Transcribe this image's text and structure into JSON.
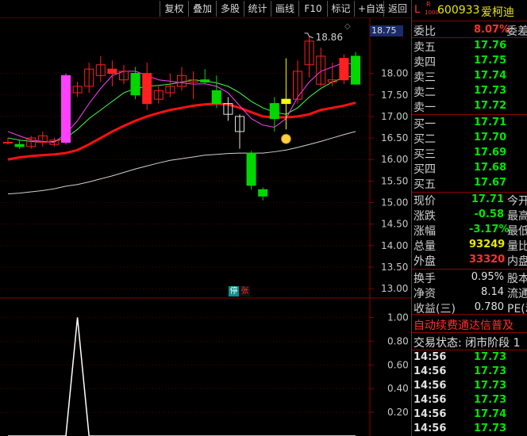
{
  "toolbar": {
    "buttons": [
      "复权",
      "叠加",
      "多股",
      "统计",
      "画线",
      "F10",
      "标记",
      "+自选",
      "返回"
    ]
  },
  "chart": {
    "current_price_box": "18.75",
    "high_annotation": "18.86",
    "y_ticks": [
      "18.00",
      "17.50",
      "17.00",
      "16.50",
      "16.00",
      "15.50",
      "15.00",
      "14.50",
      "14.00",
      "13.50",
      "13.00"
    ],
    "sub_ticks": [
      "1.00",
      "0.80",
      "0.60",
      "0.40",
      "0.20"
    ],
    "stop_badge": "停",
    "up_badge": "张",
    "colors": {
      "up": "#ff2020",
      "down": "#00d800",
      "ma5": "#ff40ff",
      "ma10": "#40ff40",
      "ma20": "#ff1010",
      "ma60": "#d0d0d0",
      "magenta_bar": "#ff40ff",
      "yellow_bar": "#ffff00"
    }
  },
  "chart_data": {
    "type": "candlestick",
    "y_range": [
      12.8,
      19.3
    ],
    "candles": [
      {
        "o": 16.4,
        "h": 16.5,
        "l": 16.35,
        "c": 16.4
      },
      {
        "o": 16.35,
        "h": 16.45,
        "l": 16.25,
        "c": 16.3
      },
      {
        "o": 16.3,
        "h": 16.55,
        "l": 16.25,
        "c": 16.5
      },
      {
        "o": 16.4,
        "h": 16.65,
        "l": 16.3,
        "c": 16.55
      },
      {
        "o": 16.35,
        "h": 16.5,
        "l": 16.3,
        "c": 16.45
      },
      {
        "o": 16.4,
        "h": 18.0,
        "l": 16.35,
        "c": 17.95
      },
      {
        "o": 17.55,
        "h": 17.8,
        "l": 17.45,
        "c": 17.7
      },
      {
        "o": 17.7,
        "h": 18.25,
        "l": 17.55,
        "c": 18.1
      },
      {
        "o": 17.95,
        "h": 18.4,
        "l": 17.8,
        "c": 18.2
      },
      {
        "o": 18.0,
        "h": 18.3,
        "l": 17.7,
        "c": 18.1
      },
      {
        "o": 17.85,
        "h": 18.2,
        "l": 17.75,
        "c": 18.05
      },
      {
        "o": 18.0,
        "h": 18.15,
        "l": 17.4,
        "c": 17.5
      },
      {
        "o": 17.3,
        "h": 18.25,
        "l": 17.15,
        "c": 18.0
      },
      {
        "o": 17.4,
        "h": 17.7,
        "l": 17.3,
        "c": 17.6
      },
      {
        "o": 17.55,
        "h": 18.0,
        "l": 17.45,
        "c": 17.7
      },
      {
        "o": 17.7,
        "h": 18.15,
        "l": 17.6,
        "c": 17.95
      },
      {
        "o": 17.8,
        "h": 18.05,
        "l": 17.4,
        "c": 17.85
      },
      {
        "o": 17.85,
        "h": 18.1,
        "l": 17.75,
        "c": 17.8
      },
      {
        "o": 17.6,
        "h": 17.95,
        "l": 17.2,
        "c": 17.3
      },
      {
        "o": 17.3,
        "h": 17.45,
        "l": 16.9,
        "c": 17.05
      },
      {
        "o": 17.0,
        "h": 17.05,
        "l": 16.25,
        "c": 16.65
      },
      {
        "o": 16.15,
        "h": 16.2,
        "l": 15.3,
        "c": 15.4
      },
      {
        "o": 15.3,
        "h": 15.35,
        "l": 15.05,
        "c": 15.15
      },
      {
        "o": 17.3,
        "h": 17.45,
        "l": 16.65,
        "c": 16.95
      },
      {
        "o": 17.3,
        "h": 18.35,
        "l": 16.7,
        "c": 17.4
      },
      {
        "o": 17.4,
        "h": 18.3,
        "l": 17.3,
        "c": 18.05
      },
      {
        "o": 18.2,
        "h": 18.86,
        "l": 17.9,
        "c": 18.75
      },
      {
        "o": 17.75,
        "h": 18.6,
        "l": 17.7,
        "c": 18.4
      },
      {
        "o": 17.8,
        "h": 18.25,
        "l": 17.7,
        "c": 17.85
      },
      {
        "o": 17.85,
        "h": 18.45,
        "l": 17.75,
        "c": 18.35
      },
      {
        "o": 18.4,
        "h": 18.5,
        "l": 17.9,
        "c": 17.75
      }
    ],
    "ma5": [
      16.65,
      16.55,
      16.45,
      16.42,
      16.4,
      16.6,
      16.9,
      17.3,
      17.65,
      17.95,
      18.05,
      18.05,
      17.95,
      17.85,
      17.82,
      17.78,
      17.75,
      17.76,
      17.7,
      17.55,
      17.25,
      16.95,
      16.8,
      16.75,
      16.95,
      17.45,
      17.8,
      18.05,
      18.15,
      18.25,
      18.2
    ],
    "ma10": [
      16.5,
      16.45,
      16.42,
      16.4,
      16.42,
      16.5,
      16.7,
      16.95,
      17.15,
      17.35,
      17.55,
      17.65,
      17.7,
      17.72,
      17.75,
      17.8,
      17.85,
      17.82,
      17.78,
      17.7,
      17.55,
      17.35,
      17.2,
      17.1,
      17.05,
      17.2,
      17.45,
      17.65,
      17.8,
      17.9,
      17.95
    ],
    "ma20": [
      16.0,
      16.05,
      16.08,
      16.1,
      16.12,
      16.15,
      16.22,
      16.35,
      16.5,
      16.65,
      16.78,
      16.9,
      17.0,
      17.08,
      17.15,
      17.2,
      17.25,
      17.28,
      17.3,
      17.28,
      17.2,
      17.1,
      17.0,
      16.98,
      16.98,
      17.0,
      17.05,
      17.15,
      17.2,
      17.25,
      17.32
    ],
    "ma60": [
      15.2,
      15.22,
      15.25,
      15.28,
      15.32,
      15.38,
      15.42,
      15.48,
      15.55,
      15.62,
      15.7,
      15.78,
      15.85,
      15.92,
      15.98,
      16.02,
      16.06,
      16.1,
      16.12,
      16.14,
      16.15,
      16.15,
      16.15,
      16.18,
      16.22,
      16.28,
      16.35,
      16.42,
      16.5,
      16.58,
      16.65
    ],
    "sub_indicator": [
      0,
      0,
      0,
      0,
      0,
      0,
      1,
      0,
      0,
      0,
      0,
      0,
      0,
      0,
      0,
      0,
      0,
      0,
      0,
      0,
      0,
      0,
      0,
      0,
      0,
      0,
      0,
      0,
      0,
      0,
      0
    ],
    "sub_range": [
      0,
      1.15
    ]
  },
  "quote": {
    "header_letters": "L",
    "r_badge": "R",
    "sub_badge": "1000",
    "code": "600933",
    "name": "爱柯迪",
    "weibi_label": "委比",
    "weibi_value": "8.07%",
    "weicha_label": "委差",
    "asks": [
      {
        "label": "卖五",
        "price": "17.76"
      },
      {
        "label": "卖四",
        "price": "17.75"
      },
      {
        "label": "卖三",
        "price": "17.74"
      },
      {
        "label": "卖二",
        "price": "17.73"
      },
      {
        "label": "卖一",
        "price": "17.72"
      }
    ],
    "bids": [
      {
        "label": "买一",
        "price": "17.71"
      },
      {
        "label": "买二",
        "price": "17.70"
      },
      {
        "label": "买三",
        "price": "17.69"
      },
      {
        "label": "买四",
        "price": "17.68"
      },
      {
        "label": "买五",
        "price": "17.67"
      }
    ],
    "stats": [
      {
        "label": "现价",
        "value": "17.71",
        "extra": "今开"
      },
      {
        "label": "涨跌",
        "value": "-0.58",
        "extra": "最高"
      },
      {
        "label": "涨幅",
        "value": "-3.17%",
        "extra": "最低"
      },
      {
        "label": "总量",
        "value": "93249",
        "extra": "量比"
      },
      {
        "label": "外盘",
        "value": "33320",
        "extra": "内盘"
      }
    ],
    "stats2": [
      {
        "label": "换手",
        "value": "0.95%",
        "extra": "股本"
      },
      {
        "label": "净资",
        "value": "8.14",
        "extra": "流通"
      },
      {
        "label": "收益(三)",
        "value": "0.780",
        "extra": "PE(动"
      }
    ],
    "notice": "自动续费通达信普及",
    "trade_state": "交易状态: 闭市阶段 1",
    "ticks": [
      {
        "time": "14:56",
        "price": "17.73"
      },
      {
        "time": "14:56",
        "price": "17.73"
      },
      {
        "time": "14:56",
        "price": "17.73"
      },
      {
        "time": "14:56",
        "price": "17.73"
      },
      {
        "time": "14:56",
        "price": "17.74"
      },
      {
        "time": "14:56",
        "price": "17.73"
      }
    ]
  }
}
